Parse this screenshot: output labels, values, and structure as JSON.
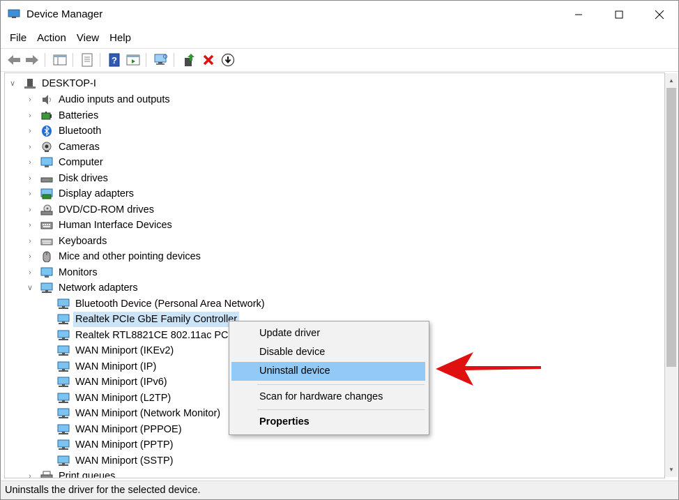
{
  "window": {
    "title": "Device Manager"
  },
  "menu": [
    "File",
    "Action",
    "View",
    "Help"
  ],
  "toolbar": {
    "buttons": [
      "back",
      "forward",
      "show-hide-console-tree",
      "properties",
      "help",
      "run",
      "scan-hardware",
      "update-driver",
      "uninstall",
      "disable"
    ]
  },
  "tree": {
    "root": "DESKTOP-I",
    "categories": [
      "Audio inputs and outputs",
      "Batteries",
      "Bluetooth",
      "Cameras",
      "Computer",
      "Disk drives",
      "Display adapters",
      "DVD/CD-ROM drives",
      "Human Interface Devices",
      "Keyboards",
      "Mice and other pointing devices",
      "Monitors",
      "Network adapters"
    ],
    "network_children": [
      "Bluetooth Device (Personal Area Network)",
      "Realtek PCIe GbE Family Controller",
      "Realtek RTL8821CE 802.11ac PCIe A",
      "WAN Miniport (IKEv2)",
      "WAN Miniport (IP)",
      "WAN Miniport (IPv6)",
      "WAN Miniport (L2TP)",
      "WAN Miniport (Network Monitor)",
      "WAN Miniport (PPPOE)",
      "WAN Miniport (PPTP)",
      "WAN Miniport (SSTP)"
    ],
    "partial": "Print queues"
  },
  "context_menu": {
    "update": "Update driver",
    "disable": "Disable device",
    "uninstall": "Uninstall device",
    "scan": "Scan for hardware changes",
    "properties": "Properties"
  },
  "status": {
    "text": "Uninstalls the driver for the selected device."
  },
  "colors": {
    "selection": "#cce4f7",
    "menu_highlight": "#91c9f7",
    "arrow": "#e01010"
  }
}
